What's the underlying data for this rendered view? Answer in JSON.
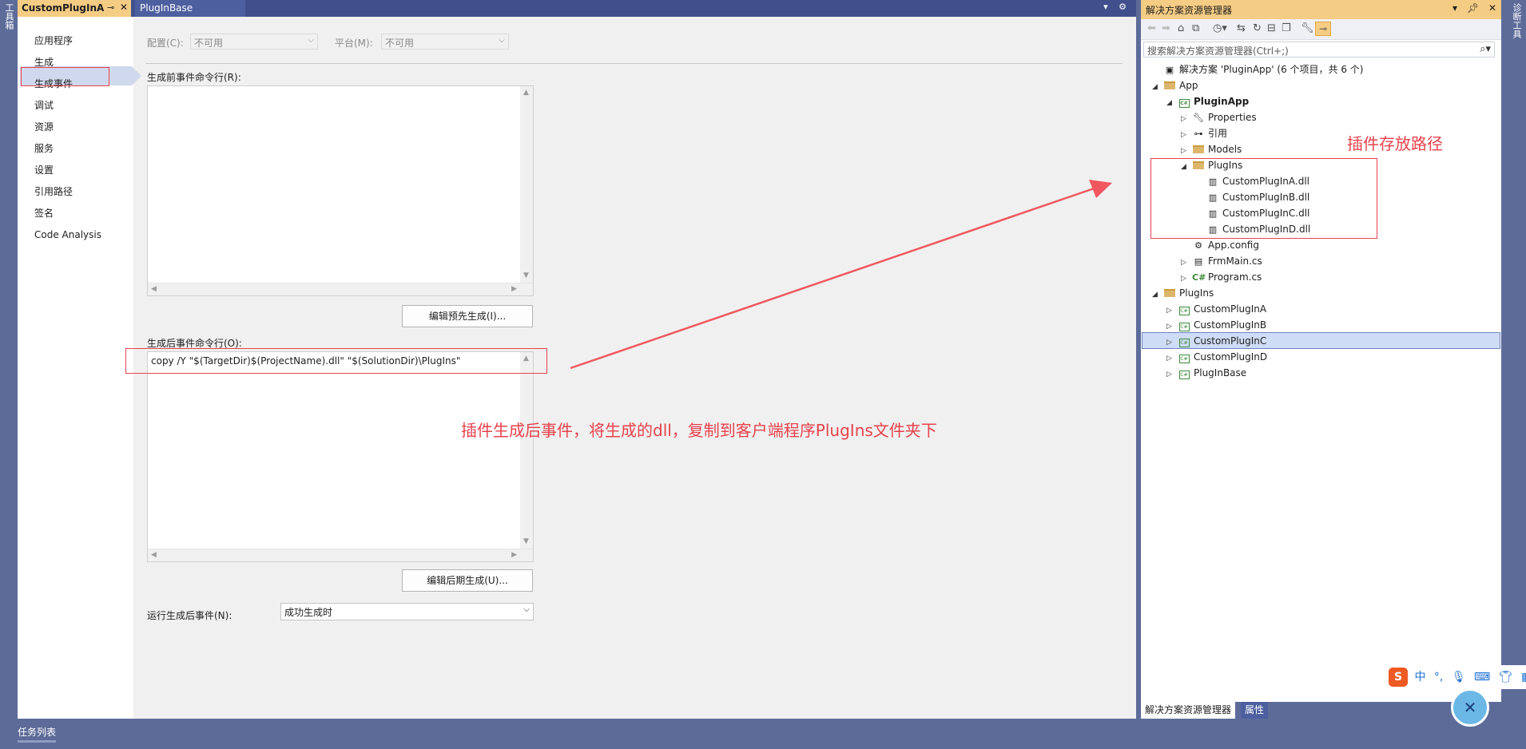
{
  "left_toolbar": {
    "label": "工具箱"
  },
  "right_toolbar": {
    "label": "诊断工具"
  },
  "tabs": [
    {
      "label": "CustomPlugInA"
    },
    {
      "label": "PlugInBase"
    }
  ],
  "sidenav": {
    "items": [
      "应用程序",
      "生成",
      "生成事件",
      "调试",
      "资源",
      "服务",
      "设置",
      "引用路径",
      "签名",
      "Code Analysis"
    ]
  },
  "form": {
    "config_label": "配置(C):",
    "config_value": "不可用",
    "platform_label": "平台(M):",
    "platform_value": "不可用",
    "prebuild_label": "生成前事件命令行(R):",
    "prebuild_value": "",
    "edit_prebuild_button": "编辑预先生成(I)...",
    "postbuild_label": "生成后事件命令行(O):",
    "postbuild_value": "copy /Y \"$(TargetDir)$(ProjectName).dll\" \"$(SolutionDir)\\PlugIns\"",
    "edit_postbuild_button": "编辑后期生成(U)...",
    "run_postbuild_label": "运行生成后事件(N):",
    "run_postbuild_value": "成功生成时"
  },
  "annotations": {
    "postbuild_note": "插件生成后事件，将生成的dll，复制到客户端程序PlugIns文件夹下",
    "plugin_path_note": "插件存放路径"
  },
  "explorer": {
    "title": "解决方案资源管理器",
    "search_placeholder": "搜索解决方案资源管理器(Ctrl+;)",
    "tree": [
      {
        "label": "解决方案 'PluginApp' (6 个项目，共 6 个)",
        "icon": "solution-icon"
      },
      {
        "label": "App",
        "icon": "folder-icon"
      },
      {
        "label": "PluginApp",
        "icon": "csproj-icon"
      },
      {
        "label": "Properties",
        "icon": "wrench-icon"
      },
      {
        "label": "引用",
        "icon": "references-icon"
      },
      {
        "label": "Models",
        "icon": "folder-icon"
      },
      {
        "label": "PlugIns",
        "icon": "folder-icon"
      },
      {
        "label": "CustomPlugInA.dll",
        "icon": "dll-icon"
      },
      {
        "label": "CustomPlugInB.dll",
        "icon": "dll-icon"
      },
      {
        "label": "CustomPlugInC.dll",
        "icon": "dll-icon"
      },
      {
        "label": "CustomPlugInD.dll",
        "icon": "dll-icon"
      },
      {
        "label": "App.config",
        "icon": "config-icon"
      },
      {
        "label": "FrmMain.cs",
        "icon": "form-icon"
      },
      {
        "label": "Program.cs",
        "icon": "csharp-icon"
      },
      {
        "label": "PlugIns",
        "icon": "folder-icon"
      },
      {
        "label": "CustomPlugInA",
        "icon": "csproj-icon"
      },
      {
        "label": "CustomPlugInB",
        "icon": "csproj-icon"
      },
      {
        "label": "CustomPlugInC",
        "icon": "csproj-icon"
      },
      {
        "label": "CustomPlugInD",
        "icon": "csproj-icon"
      },
      {
        "label": "PlugInBase",
        "icon": "csproj-icon"
      }
    ],
    "bottom_tabs": [
      "解决方案资源管理器",
      "属性"
    ]
  },
  "status_bar": {
    "task_list": "任务列表"
  },
  "ime": {
    "logo": "S",
    "mode": "中",
    "punct": "°,"
  },
  "colors": {
    "accent_tab": "#f5cc84",
    "chrome": "#5d6b99",
    "annotation_red": "#e8424c",
    "selection": "#cfdcf5"
  }
}
